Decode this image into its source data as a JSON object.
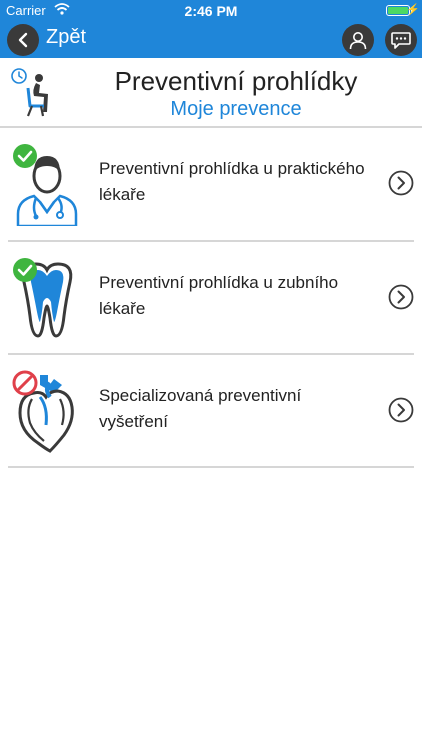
{
  "status_bar": {
    "carrier": "Carrier",
    "time": "2:46 PM"
  },
  "nav": {
    "back_label": "Zpět",
    "icons": [
      "back-chevron-icon",
      "user-icon",
      "chat-bubble-icon"
    ]
  },
  "header": {
    "title": "Preventivní prohlídky",
    "subtitle": "Moje prevence",
    "icon": "waiting-room-clock-icon"
  },
  "items": [
    {
      "label": "Preventivní prohlídka u praktického lékaře",
      "icon": "doctor-icon",
      "status": "done"
    },
    {
      "label": "Preventivní prohlídka u zubního lékaře",
      "icon": "tooth-icon",
      "status": "done"
    },
    {
      "label": "Specializovaná preventivní vyšetření",
      "icon": "heart-icon",
      "status": "not-available"
    }
  ],
  "colors": {
    "accent": "#1f86d9",
    "done": "#3fb53f",
    "blocked": "#e0404a",
    "button_dark": "#3a3a3a"
  }
}
